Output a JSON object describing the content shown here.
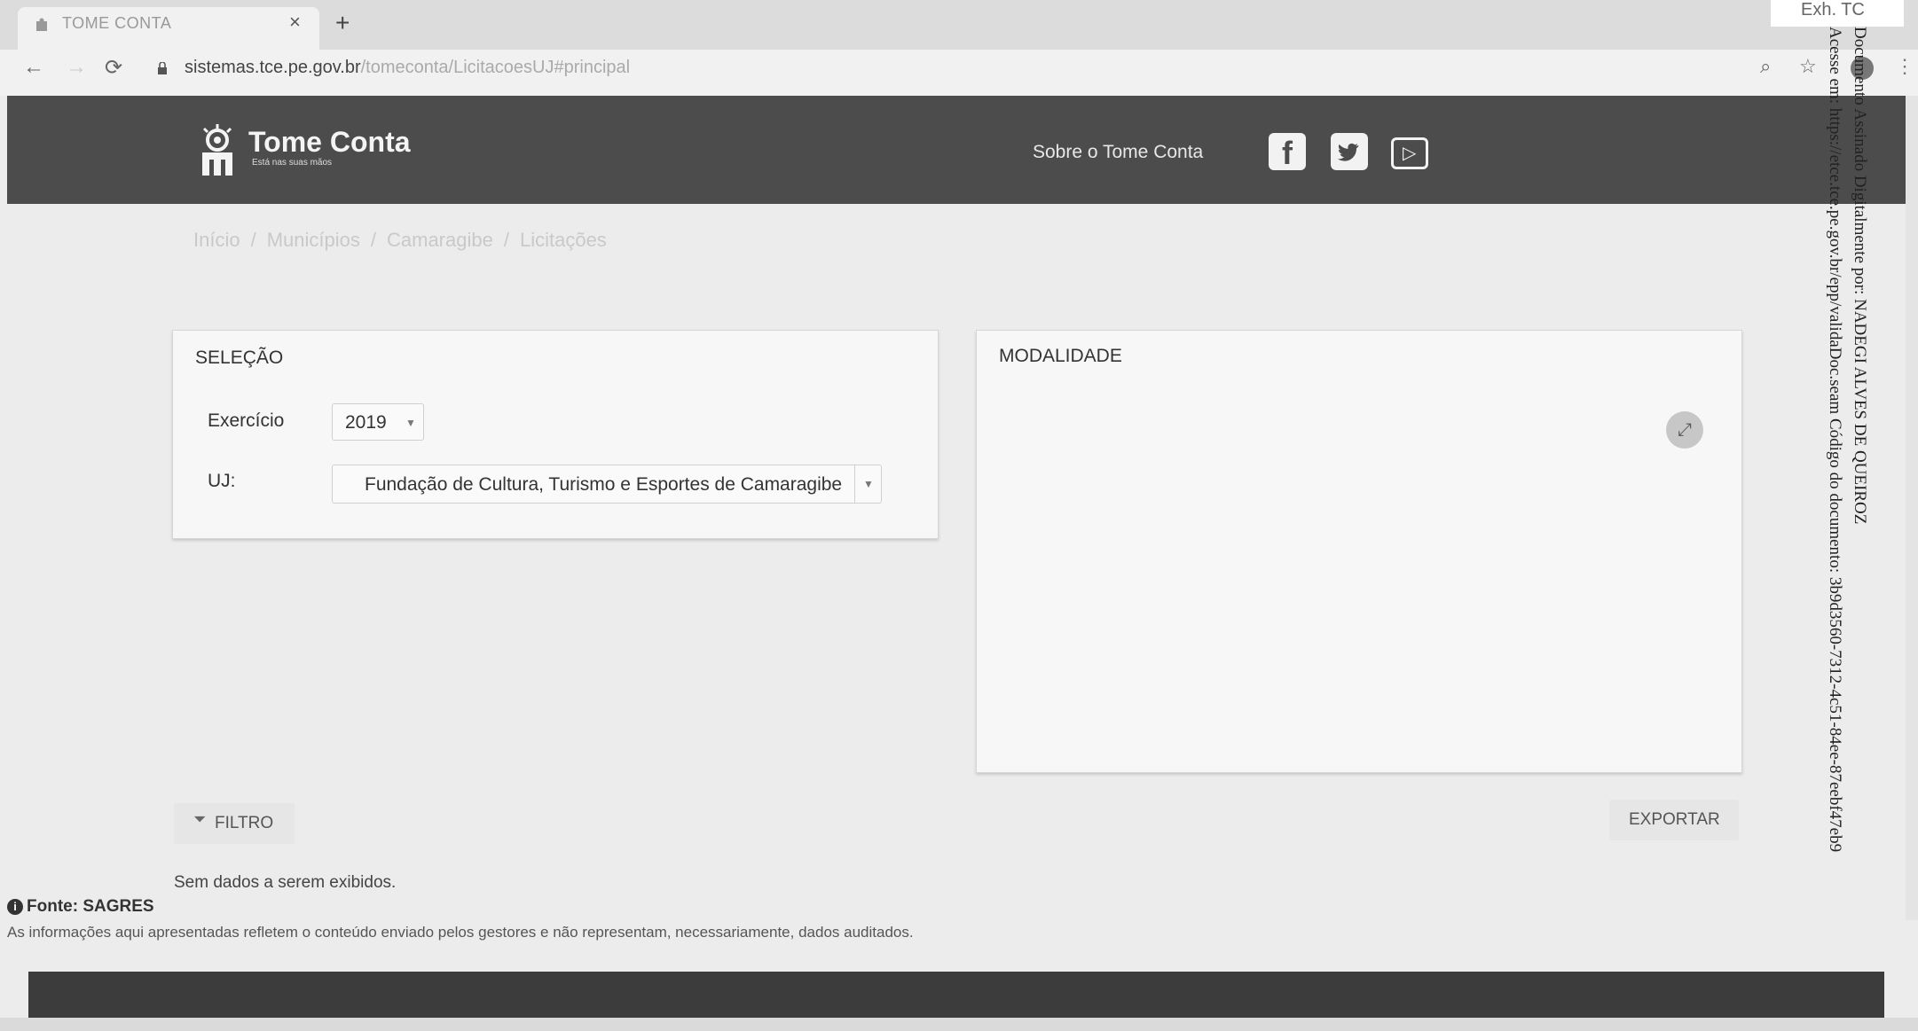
{
  "browser": {
    "tab_title": "TOME CONTA",
    "tab_close": "×",
    "new_tab": "+",
    "url_host": "sistemas.tce.pe.gov.br",
    "url_path": "/tomeconta/LicitacoesUJ#principal",
    "back": "←",
    "forward": "→",
    "reload": "⟳",
    "zoom_icon": "⌕",
    "star_icon": "☆",
    "menu_icon": "⋮"
  },
  "header": {
    "logo_text": "Tome Conta",
    "logo_tagline": "Está nas suas mãos",
    "about_link": "Sobre o Tome Conta",
    "social": [
      "facebook-icon",
      "twitter-icon",
      "youtube-icon"
    ],
    "facebook_glyph": "f",
    "youtube_glyph": "▷"
  },
  "breadcrumb": {
    "items": [
      "Início",
      "Municípios",
      "Camaragibe",
      "Licitações"
    ],
    "separator": "/"
  },
  "selection": {
    "title": "SELEÇÃO",
    "exercicio_label": "Exercício",
    "exercicio_value": "2019",
    "uj_label": "UJ:",
    "uj_value": "Fundação de Cultura, Turismo e Esportes de Camaragibe",
    "arrow": "▼"
  },
  "modalidade": {
    "title": "MODALIDADE",
    "expand_glyph": "⤢"
  },
  "actions": {
    "filtro_label": "FILTRO",
    "filtro_glyph": "⏷",
    "exportar_label": "EXPORTAR"
  },
  "results": {
    "no_data": "Sem dados a serem exibidos."
  },
  "source": {
    "fonte_label": "Fonte: SAGRES",
    "info_glyph": "i",
    "disclaimer": "As informações aqui apresentadas refletem o conteúdo enviado pelos gestores e não representam, necessariamente, dados auditados."
  },
  "stamp": {
    "corner_text": "Exh. TC",
    "line1": "Documento Assinado Digitalmente por: NADEGI ALVES DE QUEIROZ",
    "line2": "Acesse em: https://etce.tce.pe.gov.br/epp/validaDoc.seam Código do documento: 3b9d3560-7312-4c51-84ee-87eebf47eb9"
  },
  "colors": {
    "header_bg": "#4c4c4c",
    "footer_bg": "#3c3c3c",
    "page_bg": "#ececec"
  }
}
